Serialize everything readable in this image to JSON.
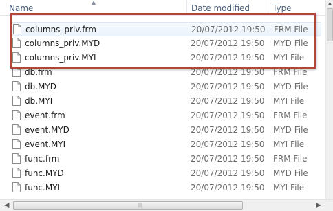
{
  "columns": {
    "name": "Name",
    "date": "Date modified",
    "type": "Type"
  },
  "icons": {
    "file": "document-file-icon",
    "sort": "sort-arrow-icon"
  },
  "colors": {
    "highlight_border": "#b5453b",
    "header_text": "#4c607a",
    "selected_bg": "#eaf2fb"
  },
  "files": [
    {
      "name": "columns_priv.frm",
      "date": "20/07/2012 19:50",
      "type": "FRM File",
      "selected": true
    },
    {
      "name": "columns_priv.MYD",
      "date": "20/07/2012 19:50",
      "type": "MYD File"
    },
    {
      "name": "columns_priv.MYI",
      "date": "20/07/2012 19:50",
      "type": "MYI File"
    },
    {
      "name": "db.frm",
      "date": "20/07/2012 19:50",
      "type": "FRM File"
    },
    {
      "name": "db.MYD",
      "date": "20/07/2012 19:50",
      "type": "MYD File"
    },
    {
      "name": "db.MYI",
      "date": "20/07/2012 19:50",
      "type": "MYI File"
    },
    {
      "name": "event.frm",
      "date": "20/07/2012 19:50",
      "type": "FRM File"
    },
    {
      "name": "event.MYD",
      "date": "20/07/2012 19:50",
      "type": "MYD File"
    },
    {
      "name": "event.MYI",
      "date": "20/07/2012 19:50",
      "type": "MYI File"
    },
    {
      "name": "func.frm",
      "date": "20/07/2012 19:50",
      "type": "FRM File"
    },
    {
      "name": "func.MYD",
      "date": "20/07/2012 19:50",
      "type": "MYD File"
    },
    {
      "name": "func.MYI",
      "date": "20/07/2012 19:50",
      "type": "MYI File"
    }
  ]
}
